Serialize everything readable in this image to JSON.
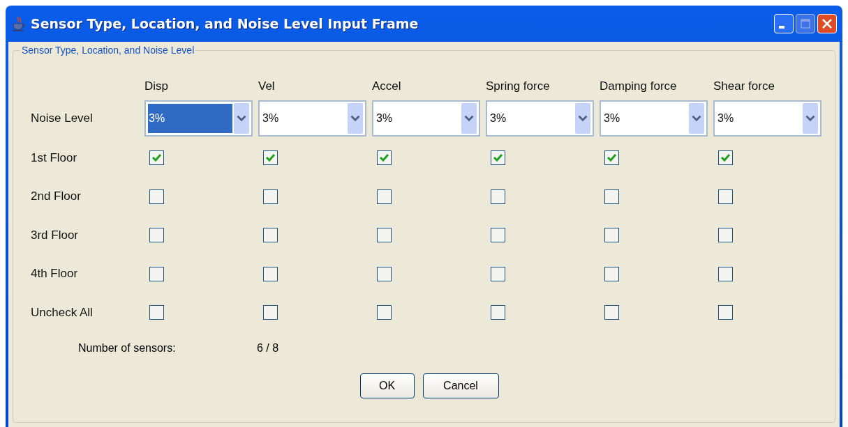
{
  "window": {
    "title": "Sensor Type, Location, and Noise Level Input Frame"
  },
  "group": {
    "title": "Sensor Type, Location, and Noise Level"
  },
  "columns": [
    "Disp",
    "Vel",
    "Accel",
    "Spring force",
    "Damping force",
    "Shear force"
  ],
  "noise": {
    "label": "Noise Level",
    "combos": [
      {
        "value": "3%",
        "focused": true
      },
      {
        "value": "3%",
        "focused": false
      },
      {
        "value": "3%",
        "focused": false
      },
      {
        "value": "3%",
        "focused": false
      },
      {
        "value": "3%",
        "focused": false
      },
      {
        "value": "3%",
        "focused": false
      }
    ]
  },
  "rows": [
    {
      "label": "1st Floor",
      "checks": [
        true,
        true,
        true,
        true,
        true,
        true
      ]
    },
    {
      "label": "2nd Floor",
      "checks": [
        false,
        false,
        false,
        false,
        false,
        false
      ]
    },
    {
      "label": "3rd Floor",
      "checks": [
        false,
        false,
        false,
        false,
        false,
        false
      ]
    },
    {
      "label": "4th Floor",
      "checks": [
        false,
        false,
        false,
        false,
        false,
        false
      ]
    },
    {
      "label": "Uncheck All",
      "checks": [
        false,
        false,
        false,
        false,
        false,
        false
      ]
    }
  ],
  "sensor_count": {
    "label": "Number of sensors:",
    "value": "6 / 8"
  },
  "buttons": [
    "OK",
    "Cancel"
  ]
}
